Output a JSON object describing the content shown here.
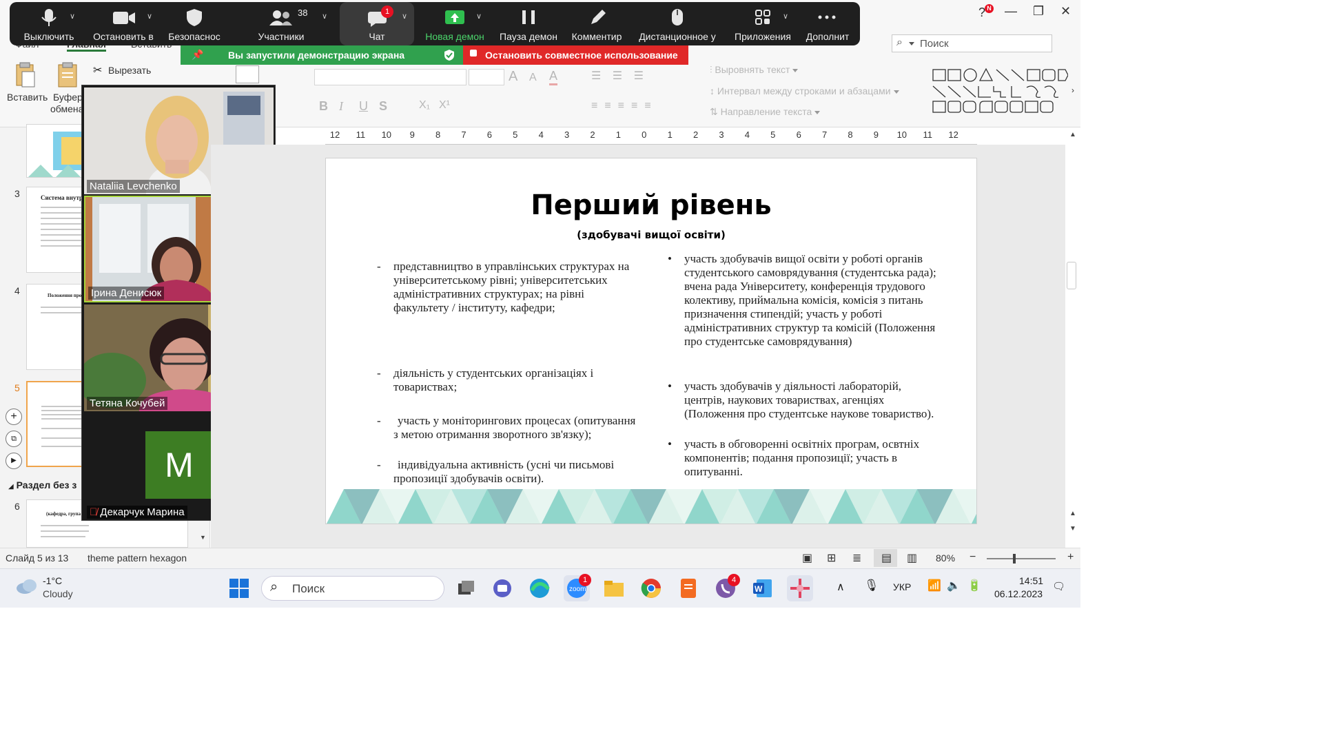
{
  "app": {
    "menu_tabs": [
      "Файл",
      "Главная",
      "Вставить"
    ],
    "ribbon": {
      "paste_label": "Вставить",
      "buffer_label_1": "Буфер",
      "buffer_label_2": "обмена",
      "cut_label": "Вырезать",
      "align_text": "Выровнять текст",
      "line_spacing": "Интервал между строками и абзацами",
      "text_direction": "Направление текста",
      "font_buttons": [
        "B",
        "I",
        "U",
        "S",
        "X₁",
        "X¹"
      ]
    },
    "search_placeholder": "Поиск",
    "notification_badge": "N"
  },
  "zoom": {
    "toolbar": [
      {
        "label": "Выключить",
        "icon": "microphone-icon"
      },
      {
        "label": "Остановить в",
        "icon": "video-camera-icon"
      },
      {
        "label": "Безопаснос",
        "icon": "shield-icon"
      },
      {
        "label": "Участники",
        "icon": "participants-icon",
        "count": "38"
      },
      {
        "label": "Чат",
        "icon": "chat-icon",
        "badge": "1"
      },
      {
        "label": "Новая демон",
        "icon": "share-screen-icon"
      },
      {
        "label": "Пауза демон",
        "icon": "pause-icon"
      },
      {
        "label": "Комментир",
        "icon": "pencil-icon"
      },
      {
        "label": "Дистанционное у",
        "icon": "mouse-icon"
      },
      {
        "label": "Приложения",
        "icon": "apps-icon"
      },
      {
        "label": "Дополнит",
        "icon": "more-icon"
      }
    ],
    "share_banner": "Вы запустили демонстрацию экрана",
    "stop_banner": "Остановить совместное использование",
    "participants": [
      {
        "name": "Nataliia Levchenko"
      },
      {
        "name": "Ірина Денисюк"
      },
      {
        "name": "Тетяна Кочубей"
      },
      {
        "name": "Декарчук Марина",
        "initial": "M",
        "muted": true
      }
    ]
  },
  "slide_panel": {
    "numbers": [
      "3",
      "4",
      "5",
      "6"
    ],
    "thumb3_title": "Система внутр",
    "thumb4_title": "Положення про сист",
    "thumb6_title": "(кафедра, група забезп",
    "section_label": "Раздел без з"
  },
  "ruler": [
    "12",
    "11",
    "10",
    "9",
    "8",
    "7",
    "6",
    "5",
    "4",
    "3",
    "2",
    "1",
    "0",
    "1",
    "2",
    "3",
    "4",
    "5",
    "6",
    "7",
    "8",
    "9",
    "10",
    "11",
    "12"
  ],
  "slide": {
    "title": "Перший рівень",
    "subtitle": "(здобувачі вищої освіти)",
    "left_bullets": [
      "представництво в управлінських структурах на університетському рівні; університетських адміністративних структурах; на рівні факультету / інституту, кафедри;",
      " діяльність у студентських організаціях і товариствах;",
      " участь у моніторингових процесах (опитування з метою отримання зворотного зв'язку);",
      " індивідуальна активність (усні чи письмові пропозиції здобувачів освіти)."
    ],
    "right_bullets": [
      "участь здобувачів вищої освіти у роботі органів студентського самоврядування (студентська рада); вчена рада Університету, конференція трудового колективу, приймальна комісія, комісія з питань призначення стипендій; участь у роботі адміністративних структур та комісій (Положення про студентське самоврядування)",
      "участь здобувачів у діяльності лабораторій, центрів, наукових товариствах, агенціях (Положення про студентське наукове товариство).",
      "участь в обговоренні освітніх програм, освтніх компонентів; подання пропозиції; участь в опитуванні."
    ],
    "accent_colors": [
      "#2e8b8b",
      "#7ccfc2",
      "#a9e0d0",
      "#d6eee6"
    ]
  },
  "status": {
    "slide_counter": "Слайд 5 из 13",
    "theme": "theme pattern hexagon",
    "zoom": "80%"
  },
  "taskbar": {
    "weather_temp": "-1°C",
    "weather_desc": "Cloudy",
    "search_label": "Поиск",
    "zoom_badge": "1",
    "viber_badge": "4",
    "lang": "УКР",
    "time": "14:51",
    "date": "06.12.2023"
  }
}
